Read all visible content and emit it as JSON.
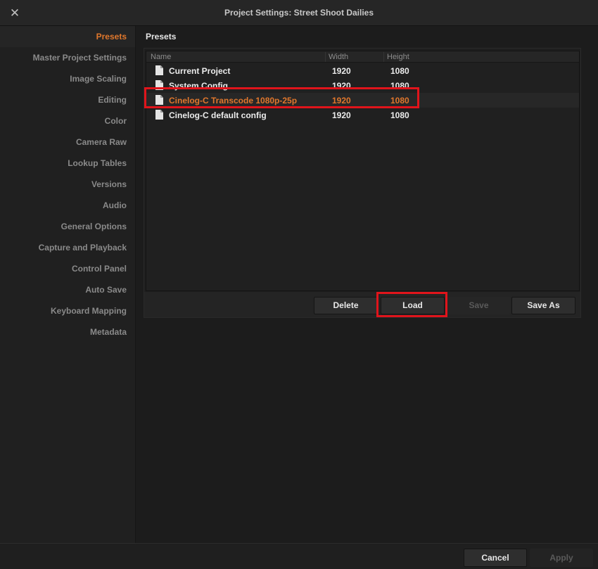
{
  "window": {
    "title": "Project Settings:  Street Shoot Dailies",
    "close_icon": "close-icon"
  },
  "sidebar": {
    "items": [
      {
        "label": "Presets",
        "active": true
      },
      {
        "label": "Master Project Settings"
      },
      {
        "label": "Image Scaling"
      },
      {
        "label": "Editing"
      },
      {
        "label": "Color"
      },
      {
        "label": "Camera Raw"
      },
      {
        "label": "Lookup Tables"
      },
      {
        "label": "Versions"
      },
      {
        "label": "Audio"
      },
      {
        "label": "General Options"
      },
      {
        "label": "Capture and Playback"
      },
      {
        "label": "Control Panel"
      },
      {
        "label": "Auto Save"
      },
      {
        "label": "Keyboard Mapping"
      },
      {
        "label": "Metadata"
      }
    ]
  },
  "main": {
    "section_title": "Presets",
    "table": {
      "columns": [
        "Name",
        "Width",
        "Height"
      ],
      "rows": [
        {
          "icon": "document-icon",
          "name": "Current Project",
          "width": "1920",
          "height": "1080"
        },
        {
          "icon": "document-icon",
          "name": "System Config",
          "width": "1920",
          "height": "1080"
        },
        {
          "icon": "document-icon",
          "name": "Cinelog-C Transcode 1080p-25p",
          "width": "1920",
          "height": "1080",
          "selected": true
        },
        {
          "icon": "document-icon",
          "name": "Cinelog-C default config",
          "width": "1920",
          "height": "1080"
        }
      ]
    },
    "buttons": {
      "delete": "Delete",
      "load": "Load",
      "save": "Save",
      "save_as": "Save As"
    }
  },
  "footer": {
    "cancel": "Cancel",
    "apply": "Apply"
  },
  "colors": {
    "accent": "#e0772c",
    "highlight": "#e0141b",
    "background": "#1c1c1c"
  }
}
